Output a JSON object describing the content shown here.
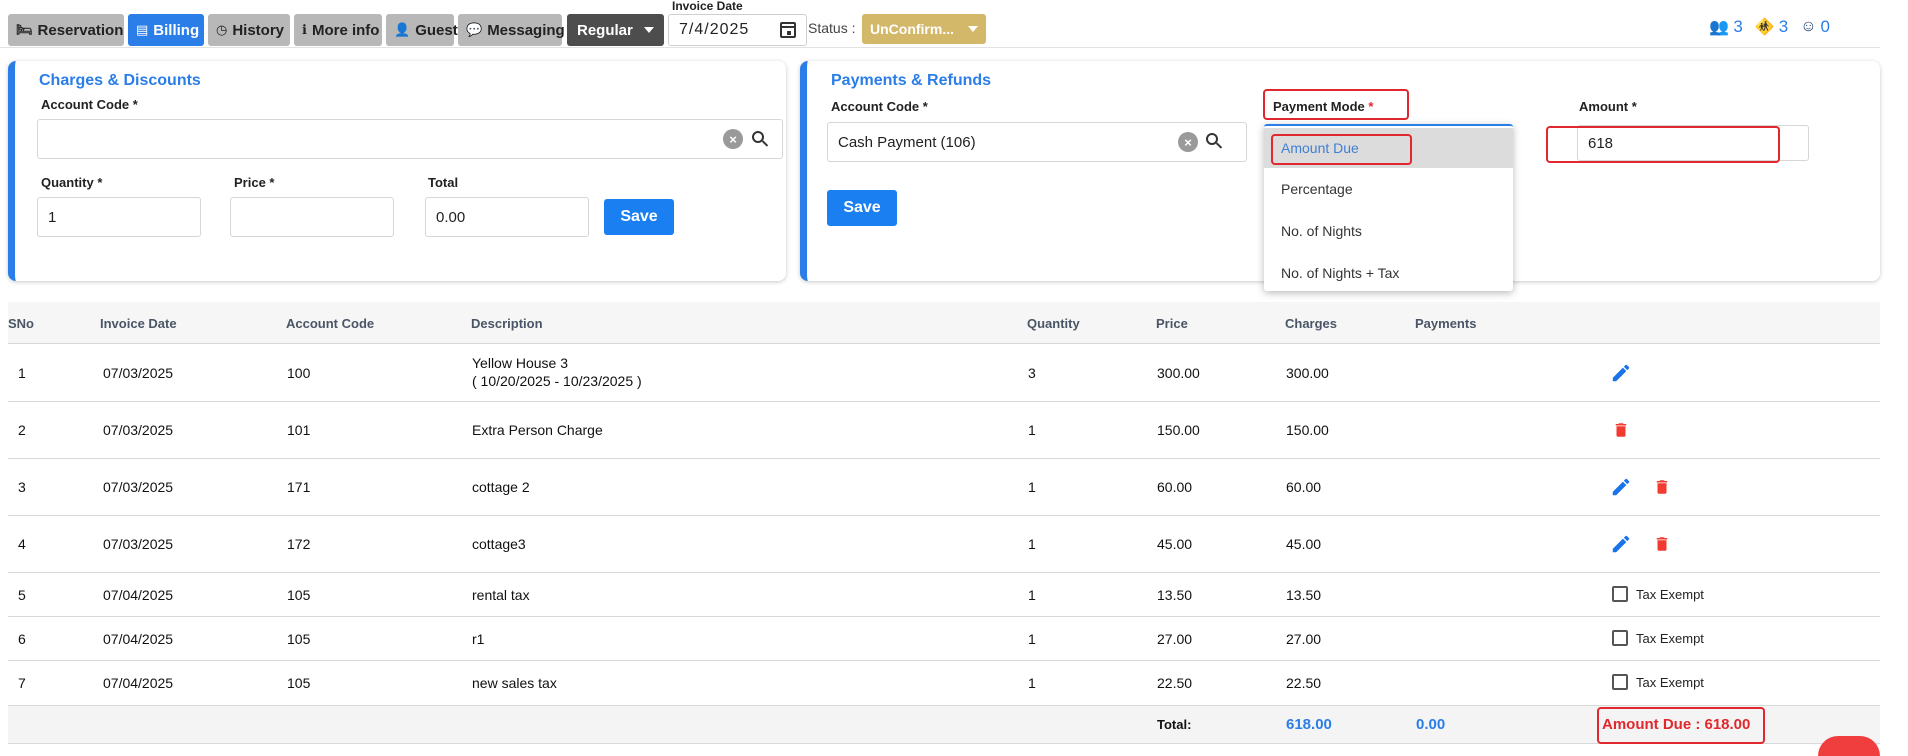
{
  "tabs": [
    {
      "label": "Reservation",
      "icon": "bed-icon",
      "active": false
    },
    {
      "label": "Billing",
      "icon": "list-icon",
      "active": true
    },
    {
      "label": "History",
      "icon": "clock-icon",
      "active": false
    },
    {
      "label": "More info",
      "icon": "info-icon",
      "active": false
    },
    {
      "label": "Guest",
      "icon": "user-icon",
      "active": false
    },
    {
      "label": "Messaging",
      "icon": "chat-icon",
      "active": false
    }
  ],
  "rate_type": "Regular",
  "invoice_date": {
    "label": "Invoice Date",
    "value": "7/4/2025"
  },
  "status": {
    "label": "Status :",
    "value": "UnConfirm..."
  },
  "counts": {
    "adults": "3",
    "children": "3",
    "infants": "0"
  },
  "charges": {
    "title": "Charges & Discounts",
    "account_code_label": "Account Code *",
    "account_code_value": "",
    "quantity_label": "Quantity *",
    "quantity_value": "1",
    "price_label": "Price *",
    "price_value": "",
    "total_label": "Total",
    "total_value": "0.00",
    "save_label": "Save"
  },
  "payments": {
    "title": "Payments & Refunds",
    "account_code_label": "Account Code *",
    "account_code_value": "Cash Payment  (106)",
    "payment_mode_label": "Payment Mode",
    "payment_mode_required": "*",
    "amount_label": "Amount *",
    "amount_value": "618",
    "save_label": "Save",
    "mode_options": [
      "Amount Due",
      "Percentage",
      "No. of Nights",
      "No. of Nights + Tax"
    ]
  },
  "table": {
    "headers": [
      "SNo",
      "Invoice Date",
      "Account Code",
      "Description",
      "Quantity",
      "Price",
      "Charges",
      "Payments"
    ],
    "rows": [
      {
        "sno": "1",
        "date": "07/03/2025",
        "code": "100",
        "desc": "Yellow House 3",
        "desc_sub": "( 10/20/2025 - 10/23/2025 )",
        "qty": "3",
        "price": "300.00",
        "charges": "300.00",
        "actions": "edit"
      },
      {
        "sno": "2",
        "date": "07/03/2025",
        "code": "101",
        "desc": "Extra Person Charge",
        "qty": "1",
        "price": "150.00",
        "charges": "150.00",
        "actions": "delete"
      },
      {
        "sno": "3",
        "date": "07/03/2025",
        "code": "171",
        "desc": "cottage 2",
        "qty": "1",
        "price": "60.00",
        "charges": "60.00",
        "actions": "edit-delete"
      },
      {
        "sno": "4",
        "date": "07/03/2025",
        "code": "172",
        "desc": "cottage3",
        "qty": "1",
        "price": "45.00",
        "charges": "45.00",
        "actions": "edit-delete"
      },
      {
        "sno": "5",
        "date": "07/04/2025",
        "code": "105",
        "desc": "rental tax",
        "qty": "1",
        "price": "13.50",
        "charges": "13.50",
        "actions": "tax"
      },
      {
        "sno": "6",
        "date": "07/04/2025",
        "code": "105",
        "desc": "r1",
        "qty": "1",
        "price": "27.00",
        "charges": "27.00",
        "actions": "tax"
      },
      {
        "sno": "7",
        "date": "07/04/2025",
        "code": "105",
        "desc": "new sales tax",
        "qty": "1",
        "price": "22.50",
        "charges": "22.50",
        "actions": "tax"
      }
    ],
    "tax_exempt_label": "Tax Exempt",
    "total_label": "Total:",
    "total_charges": "618.00",
    "total_payments": "0.00",
    "amount_due": "Amount Due : 618.00"
  },
  "colors": {
    "accent": "#2b7ee8",
    "danger": "#e0282e",
    "status": "#d4b86a"
  }
}
